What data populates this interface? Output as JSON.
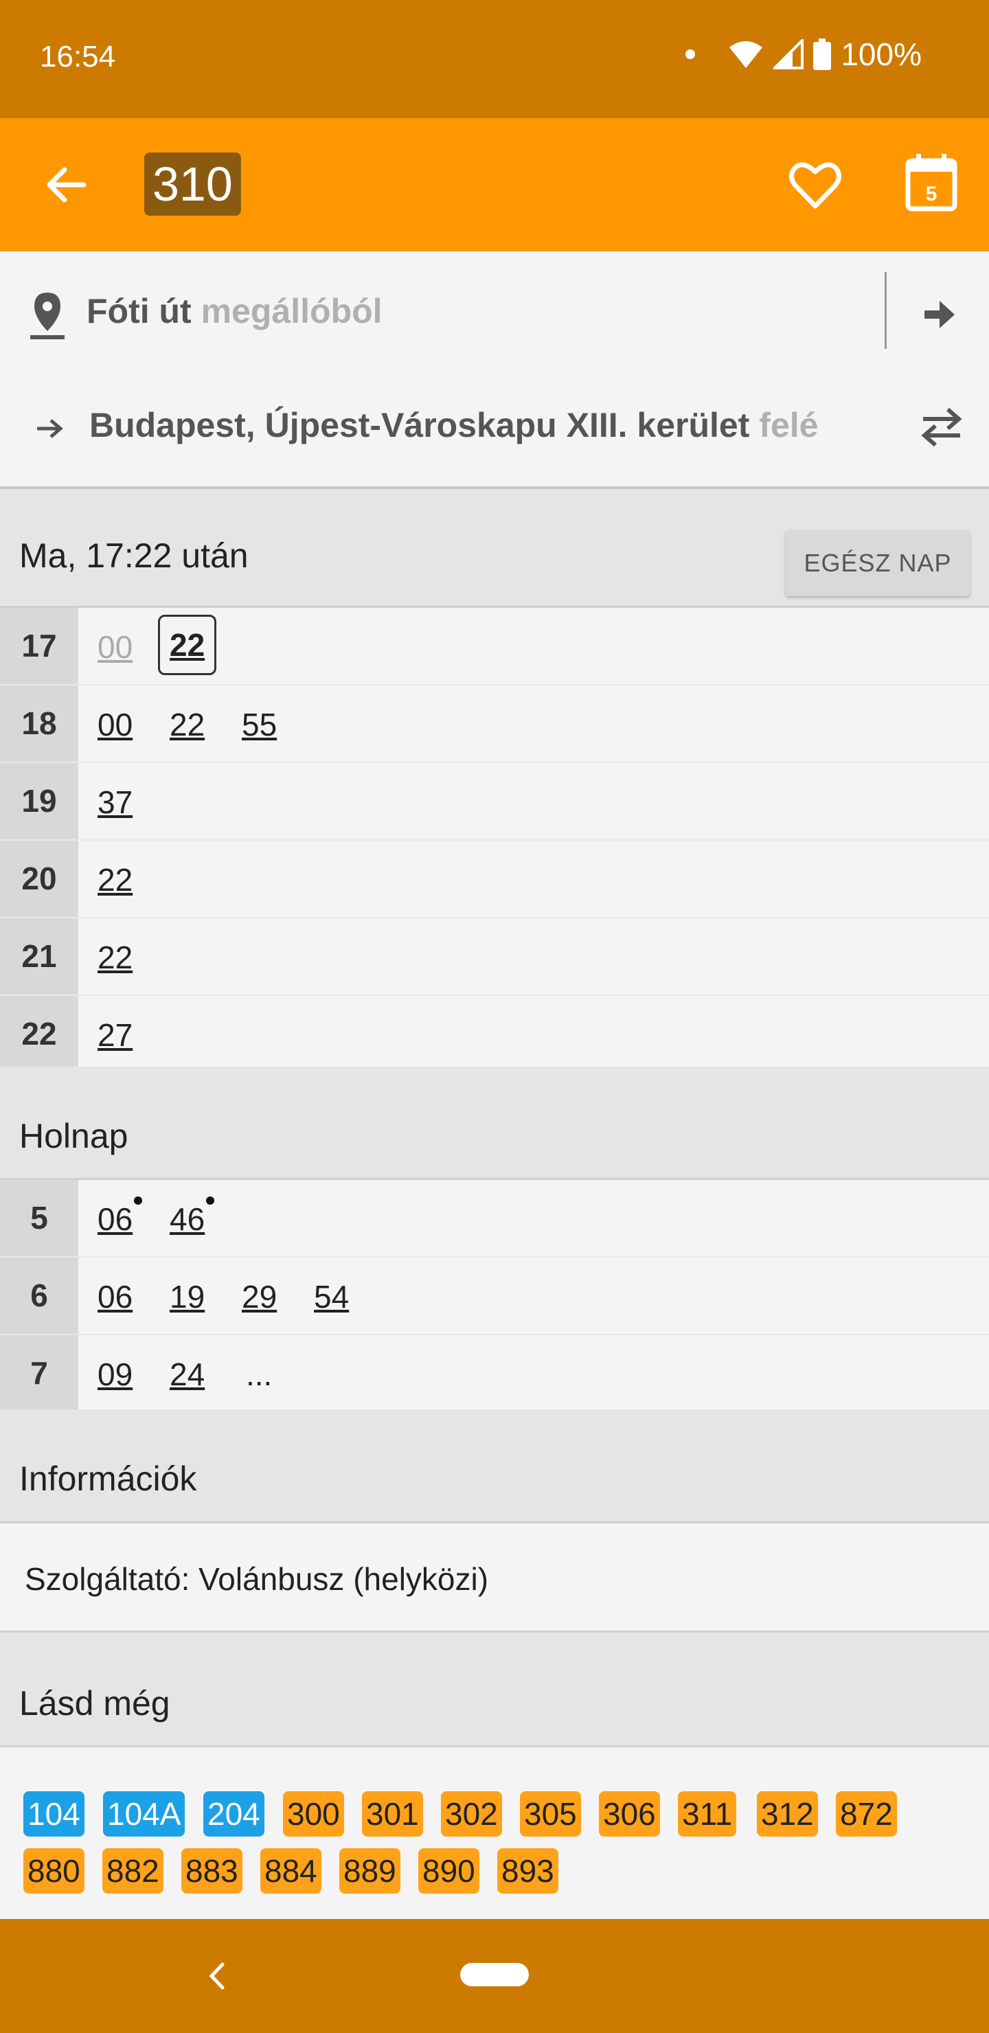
{
  "status": {
    "time": "16:54",
    "battery": "100%"
  },
  "appbar": {
    "route": "310"
  },
  "stop": {
    "name": "Fóti út",
    "suffix": "megállóból"
  },
  "direction": {
    "name": "Budapest, Újpest-Városkapu XIII. kerület",
    "suffix": "felé"
  },
  "today": {
    "header": "Ma, 17:22 után",
    "all_day_button": "EGÉSZ NAP",
    "rows": [
      {
        "hour": "17",
        "minutes": [
          "00",
          "22"
        ]
      },
      {
        "hour": "18",
        "minutes": [
          "00",
          "22",
          "55"
        ]
      },
      {
        "hour": "19",
        "minutes": [
          "37"
        ]
      },
      {
        "hour": "20",
        "minutes": [
          "22"
        ]
      },
      {
        "hour": "21",
        "minutes": [
          "22"
        ]
      },
      {
        "hour": "22",
        "minutes": [
          "27"
        ]
      }
    ]
  },
  "tomorrow": {
    "header": "Holnap",
    "rows": [
      {
        "hour": "5",
        "minutes": [
          "06",
          "46"
        ]
      },
      {
        "hour": "6",
        "minutes": [
          "06",
          "19",
          "29",
          "54"
        ]
      },
      {
        "hour": "7",
        "minutes": [
          "09",
          "24",
          "..."
        ]
      }
    ]
  },
  "info": {
    "header": "Információk",
    "operator": "Szolgáltató: Volánbusz (helyközi)"
  },
  "see_also": {
    "header": "Lásd még",
    "routes": [
      "104",
      "104A",
      "204",
      "300",
      "301",
      "302",
      "305",
      "306",
      "311",
      "312",
      "872",
      "880",
      "882",
      "883",
      "884",
      "889",
      "890",
      "893"
    ]
  },
  "colors": {
    "status_bar": "#cc7a00",
    "app_bar": "#ff9800",
    "chip_blue": "#1da1e6",
    "chip_orange": "#ffa21a"
  }
}
